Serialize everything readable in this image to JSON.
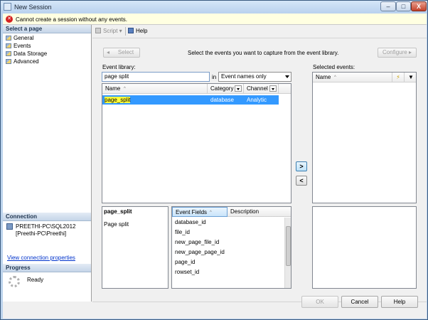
{
  "window": {
    "title": "New Session",
    "controls": {
      "minimize": "–",
      "maximize": "□",
      "close": "X"
    }
  },
  "error": {
    "icon": "error-icon",
    "message": "Cannot create a session without any events."
  },
  "sidebar": {
    "pages_header": "Select a page",
    "pages": [
      {
        "label": "General"
      },
      {
        "label": "Events"
      },
      {
        "label": "Data Storage"
      },
      {
        "label": "Advanced"
      }
    ],
    "connection_header": "Connection",
    "server": "PREETHI-PC\\SQL2012",
    "user": "[Preethi-PC\\Preethi]",
    "view_connection_link": "View connection properties",
    "progress_header": "Progress",
    "progress_status": "Ready"
  },
  "toolbar": {
    "script_label": "Script",
    "help_label": "Help"
  },
  "events": {
    "select_button": "Select",
    "instruction": "Select the events you want to capture from the event library.",
    "configure_button": "Configure",
    "library_label": "Event library:",
    "search_value": "page split",
    "in_label": "in",
    "filter_value": "Event names only",
    "columns": {
      "name": "Name",
      "category": "Category",
      "channel": "Channel"
    },
    "rows": [
      {
        "name_part1": "page",
        "name_part2": "split",
        "category": "database",
        "channel": "Analytic"
      }
    ],
    "selected_label": "Selected events:",
    "selected_name_col": "Name",
    "add_button": ">",
    "remove_button": "<",
    "detail_name": "page_split",
    "detail_desc": "Page split",
    "fields_columns": {
      "fields": "Event Fields",
      "description": "Description"
    },
    "fields": [
      "database_id",
      "file_id",
      "new_page_file_id",
      "new_page_page_id",
      "page_id",
      "rowset_id"
    ]
  },
  "buttons": {
    "ok": "OK",
    "cancel": "Cancel",
    "help": "Help"
  }
}
